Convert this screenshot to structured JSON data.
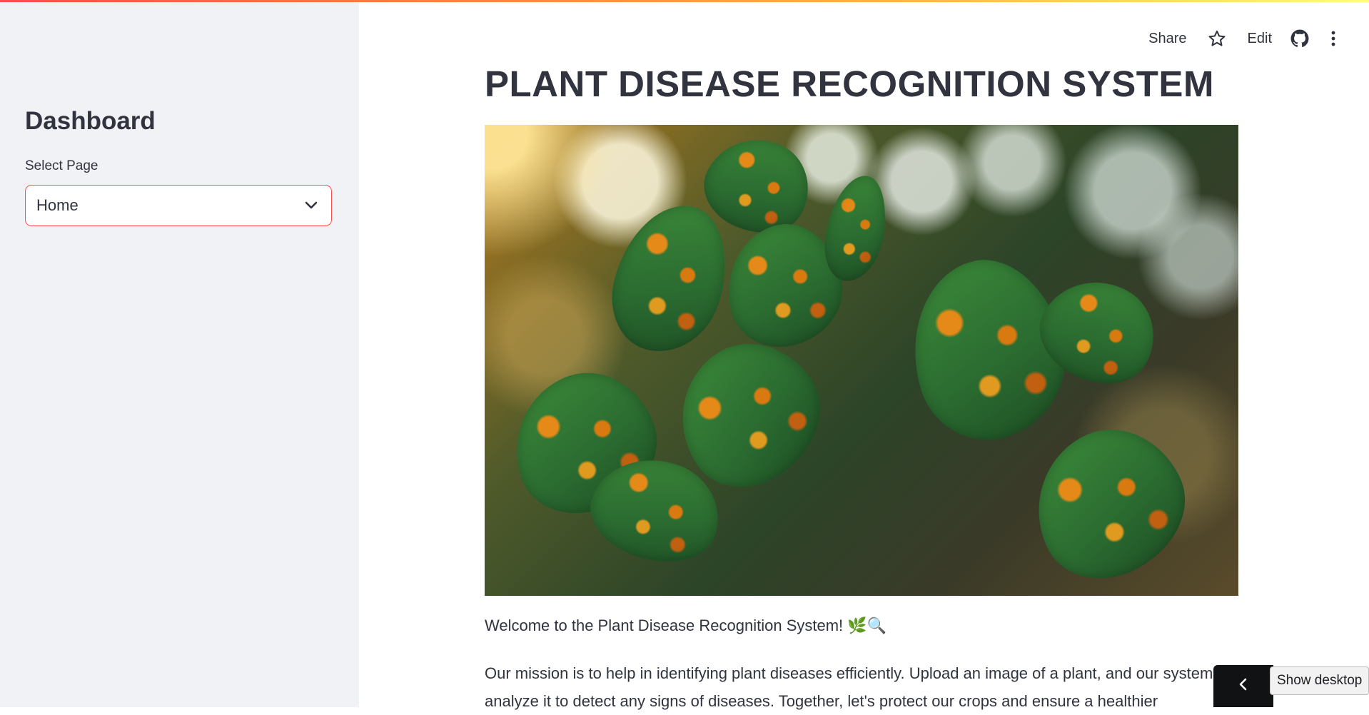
{
  "sidebar": {
    "title": "Dashboard",
    "select_label": "Select Page",
    "select_value": "Home"
  },
  "toolbar": {
    "share_label": "Share",
    "edit_label": "Edit",
    "icons": [
      "star-icon",
      "github-icon",
      "more-vertical-icon"
    ]
  },
  "main": {
    "title": "PLANT DISEASE RECOGNITION SYSTEM",
    "welcome_text": "Welcome to the Plant Disease Recognition System! 🌿🔍",
    "mission_text": "Our mission is to help in identifying plant diseases efficiently. Upload an image of a plant, and our system will analyze it to detect any signs of diseases. Together, let's protect our crops and ensure a healthier"
  },
  "taskbar": {
    "show_desktop_label": "Show desktop"
  },
  "colors": {
    "accent": "#ff4b4b",
    "sidebar_bg": "#f0f2f6",
    "text": "#31333f"
  }
}
